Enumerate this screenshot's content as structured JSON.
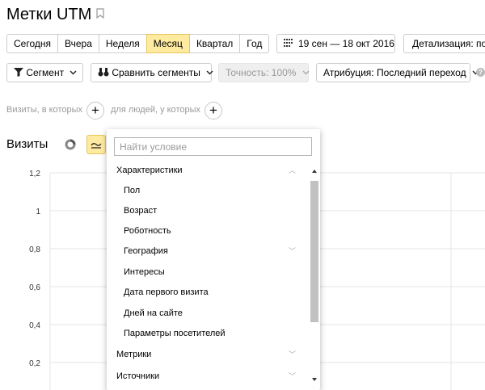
{
  "title": "Метки UTM",
  "periods": [
    {
      "label": "Сегодня",
      "active": false
    },
    {
      "label": "Вчера",
      "active": false
    },
    {
      "label": "Неделя",
      "active": false
    },
    {
      "label": "Месяц",
      "active": true
    },
    {
      "label": "Квартал",
      "active": false
    },
    {
      "label": "Год",
      "active": false
    }
  ],
  "date_range": "19 сен — 18 окт 2016",
  "detail_label": "Детализация: по д",
  "toolbar": {
    "segment": "Сегмент",
    "compare": "Сравнить сегменты",
    "accuracy": "Точность: 100%",
    "attribution": "Атрибуция: Последний переход",
    "help": "?"
  },
  "conditions": {
    "visits_where": "Визиты, в которых",
    "for_people": "для людей, у которых"
  },
  "visits_title": "Визиты",
  "dropdown": {
    "search_placeholder": "Найти условие",
    "groups": [
      {
        "label": "Характеристики",
        "type": "group",
        "arrow": "up"
      },
      {
        "label": "Пол",
        "type": "sub"
      },
      {
        "label": "Возраст",
        "type": "sub"
      },
      {
        "label": "Роботность",
        "type": "sub"
      },
      {
        "label": "География",
        "type": "sub",
        "arrow": "down"
      },
      {
        "label": "Интересы",
        "type": "sub"
      },
      {
        "label": "Дата первого визита",
        "type": "sub"
      },
      {
        "label": "Дней на сайте",
        "type": "sub"
      },
      {
        "label": "Параметры посетителей",
        "type": "sub"
      },
      {
        "label": "Метрики",
        "type": "group",
        "arrow": "down"
      },
      {
        "label": "Источники",
        "type": "group",
        "arrow": "down"
      }
    ]
  },
  "chart_data": {
    "type": "line",
    "yticks": [
      "1,2",
      "1",
      "0,8",
      "0,6",
      "0,4",
      "0,2"
    ],
    "ylim": [
      0,
      1.2
    ],
    "grid": true,
    "series": []
  },
  "colors": {
    "accent": "#ffeba0",
    "accent_border": "#e6c45c",
    "line": "#a6c95a"
  }
}
